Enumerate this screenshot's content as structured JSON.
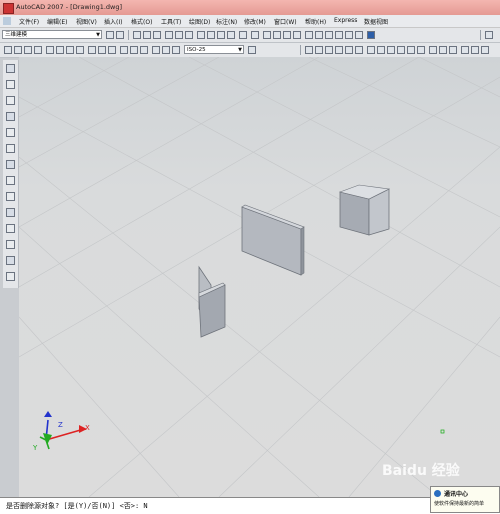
{
  "window": {
    "title": "AutoCAD 2007 - [Drawing1.dwg]"
  },
  "menu": {
    "items": [
      "文件(F)",
      "编辑(E)",
      "视图(V)",
      "插入(I)",
      "格式(O)",
      "工具(T)",
      "绘图(D)",
      "标注(N)",
      "修改(M)",
      "窗口(W)",
      "帮助(H)",
      "Express",
      "数据视图"
    ]
  },
  "toolbar": {
    "workspace_value": "三维建模",
    "dimstyle_value": "ISO-25"
  },
  "command_line": {
    "text": "是否删除源对象? [是(Y)/否(N)] <否>: N"
  },
  "notification": {
    "title": "通讯中心",
    "body": "使软件保持最新的简单"
  },
  "watermark": {
    "text": "Baidu 经验"
  },
  "colors": {
    "titlebar": "#e8a29b",
    "viewport": "#d6d8da",
    "ucs_x": "#d22",
    "ucs_y": "#2a2",
    "ucs_z": "#23c"
  },
  "icons": [
    "line-icon",
    "polyline-icon",
    "polygon-icon",
    "rectangle-icon",
    "arc-icon",
    "circle-icon",
    "spline-icon",
    "ellipse-icon",
    "insert-block-icon",
    "point-icon",
    "hatch-icon",
    "region-icon",
    "table-icon",
    "text-icon"
  ]
}
